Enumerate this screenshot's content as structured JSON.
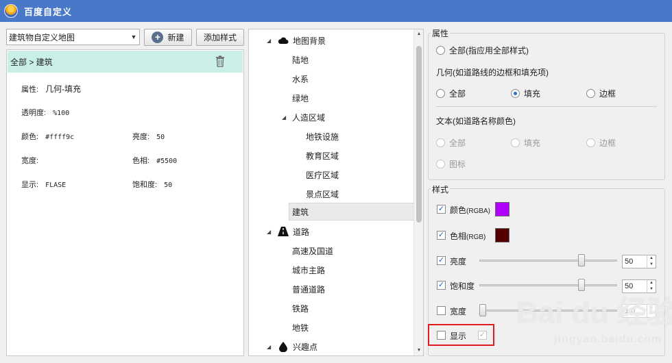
{
  "window": {
    "title": "百度自定义"
  },
  "toolbar": {
    "map_select": "建筑物自定义地图",
    "new_label": "新建",
    "add_style_label": "添加样式"
  },
  "left": {
    "breadcrumb": "全部 > 建筑",
    "props": {
      "attr_label": "属性:",
      "attr_value": "几何-填充",
      "opacity_label": "透明度:",
      "opacity_value": "%100",
      "color_label": "颜色:",
      "color_value": "#ffff9c",
      "brightness_label": "亮度:",
      "brightness_value": "50",
      "width_label": "宽度:",
      "width_value": "",
      "hue_label": "色相:",
      "hue_value": "#5500",
      "show_label": "显示:",
      "show_value": "FLASE",
      "saturation_label": "饱和度:",
      "saturation_value": "50"
    }
  },
  "tree": {
    "items": [
      {
        "label": "地图背景",
        "icon": "cloud-icon"
      },
      {
        "label": "陆地"
      },
      {
        "label": "水系"
      },
      {
        "label": "绿地"
      },
      {
        "label": "人造区域"
      },
      {
        "label": "地铁设施"
      },
      {
        "label": "教育区域"
      },
      {
        "label": "医疗区域"
      },
      {
        "label": "景点区域"
      },
      {
        "label": "建筑"
      },
      {
        "label": "道路",
        "icon": "road-icon"
      },
      {
        "label": "高速及国道"
      },
      {
        "label": "城市主路"
      },
      {
        "label": "普通道路"
      },
      {
        "label": "铁路"
      },
      {
        "label": "地铁"
      },
      {
        "label": "兴趣点",
        "icon": "drop-icon"
      }
    ]
  },
  "props_group": {
    "title": "属性",
    "all_label": "全部(指应用全部样式)",
    "geometry_title": "几何(如道路线的边框和填充项)",
    "geo_all": "全部",
    "geo_fill": "填充",
    "geo_border": "边框",
    "text_title": "文本(如道路名称颜色)",
    "text_all": "全部",
    "text_fill": "填充",
    "text_border": "边框",
    "text_icon": "图标"
  },
  "style_group": {
    "title": "样式",
    "color_label": "颜色",
    "color_hint": "(RGBA)",
    "color_swatch": "#b000ff",
    "hue_label": "色相",
    "hue_hint": "(RGB)",
    "hue_swatch": "#550000",
    "brightness_label": "亮度",
    "brightness_value": "50",
    "saturation_label": "饱和度",
    "saturation_value": "50",
    "width_label": "宽度",
    "width_value": "1.0",
    "show_label": "显示"
  },
  "watermark": {
    "brand": "Bai du 经验",
    "url": "jingyan.baidu.com"
  }
}
